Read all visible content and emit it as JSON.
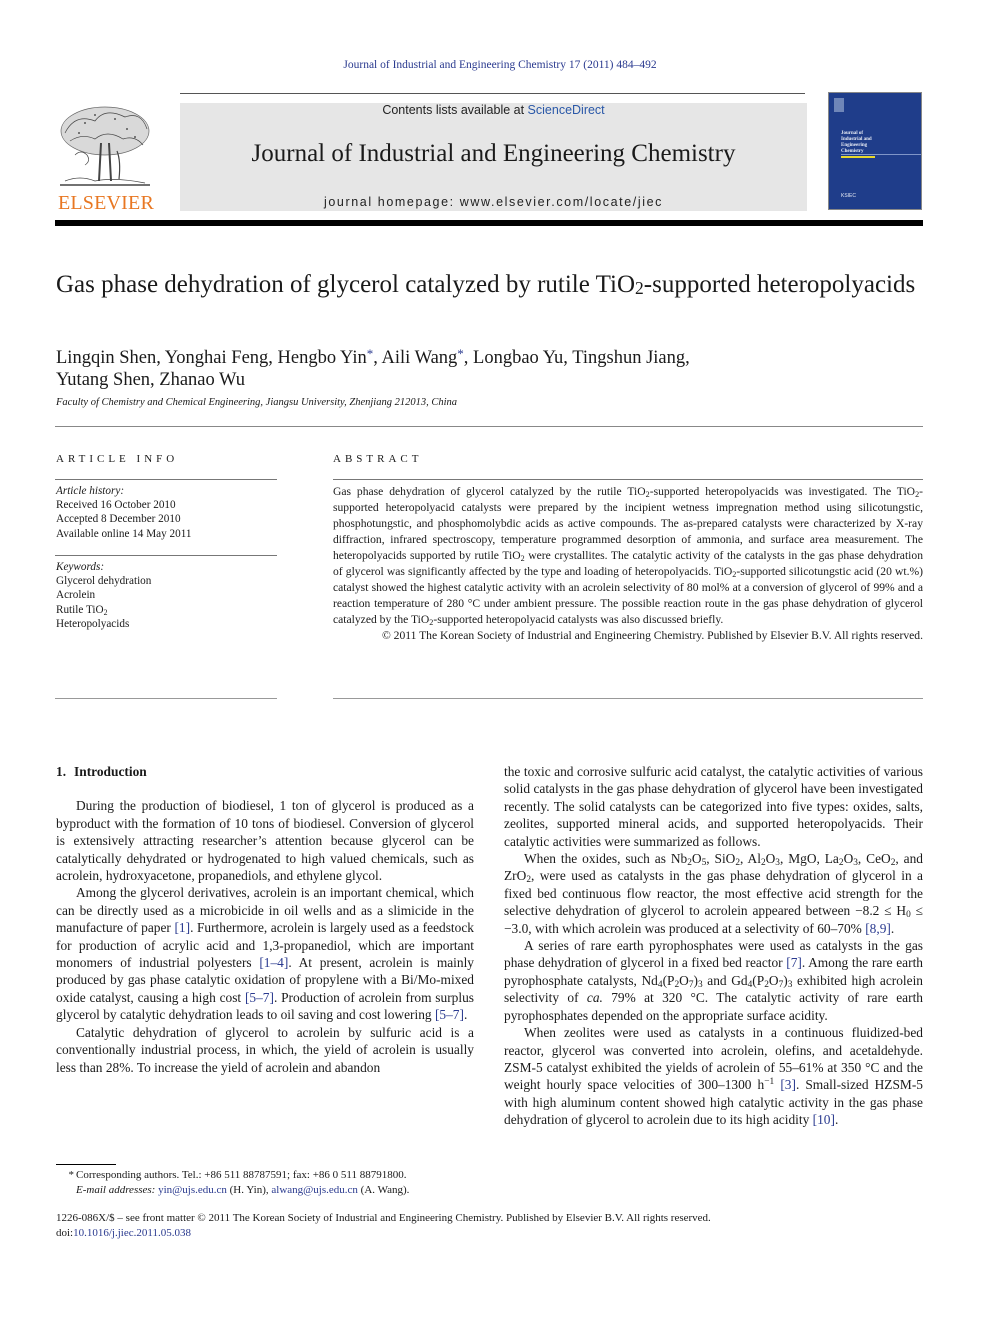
{
  "header": {
    "journal_reference": "Journal of Industrial and Engineering Chemistry 17 (2011) 484–492",
    "contents_prefix": "Contents lists available at ",
    "contents_link": "ScienceDirect",
    "journal_title": "Journal of Industrial and Engineering Chemistry",
    "homepage": "journal homepage: www.elsevier.com/locate/jiec",
    "publisher_logo_text": "ELSEVIER",
    "cover": {
      "title_lines": [
        "Journal of",
        "Industrial and",
        "Engineering",
        "Chemistry"
      ],
      "society": "The Korean Society of Industrial and Engineering Chemistry",
      "color": "#1f3d8a"
    }
  },
  "article": {
    "title_part1": "Gas phase dehydration of glycerol catalyzed by rutile TiO",
    "title_sub": "2",
    "title_part2": "-supported heteropolyacids",
    "authors": [
      {
        "name": "Lingqin Shen",
        "corresponding": false
      },
      {
        "name": "Yonghai Feng",
        "corresponding": false
      },
      {
        "name": "Hengbo Yin",
        "corresponding": true
      },
      {
        "name": "Aili Wang",
        "corresponding": true
      },
      {
        "name": "Longbao Yu",
        "corresponding": false
      },
      {
        "name": "Tingshun Jiang",
        "corresponding": false
      },
      {
        "name": "Yutang Shen",
        "corresponding": false
      },
      {
        "name": "Zhanao Wu",
        "corresponding": false
      }
    ],
    "corresponding_mark": "*",
    "affiliation": "Faculty of Chemistry and Chemical Engineering, Jiangsu University, Zhenjiang 212013, China"
  },
  "article_info": {
    "heading": "ARTICLE INFO",
    "history_label": "Article history:",
    "history": [
      "Received 16 October 2010",
      "Accepted 8 December 2010",
      "Available online 14 May 2011"
    ],
    "keywords_label": "Keywords:",
    "keywords": [
      "Glycerol dehydration",
      "Acrolein",
      "Rutile TiO",
      "Heteropolyacids"
    ],
    "keyword_sub": "2"
  },
  "abstract": {
    "heading": "ABSTRACT",
    "s1a": "Gas phase dehydration of glycerol catalyzed by the rutile TiO",
    "s1b": "-supported heteropolyacids was investigated. The TiO",
    "s1c": "-supported heteropolyacid catalysts were prepared by the incipient wetness impregnation method using silicotungstic, phosphotungstic, and phosphomolybdic acids as active compounds. The as-prepared catalysts were characterized by X-ray diffraction, infrared spectroscopy, temperature programmed desorption of ammonia, and surface area measurement. The heteropolyacids supported by rutile TiO",
    "s1d": " were crystallites. The catalytic activity of the catalysts in the gas phase dehydration of glycerol was significantly affected by the type and loading of heteropolyacids. TiO",
    "s1e": "-supported silicotungstic acid (20 wt.%) catalyst showed the highest catalytic activity with an acrolein selectivity of 80 mol% at a conversion of glycerol of 99% and a reaction temperature of 280 °C under ambient pressure. The possible reaction route in the gas phase dehydration of glycerol catalyzed by the TiO",
    "s1f": "-supported heteropolyacid catalysts was also discussed briefly.",
    "sub": "2",
    "copyright": "© 2011 The Korean Society of Industrial and Engineering Chemistry. Published by Elsevier B.V. All rights reserved."
  },
  "body": {
    "section_number": "1.",
    "section_title": "Introduction",
    "p1": "During the production of biodiesel, 1 ton of glycerol is produced as a byproduct with the formation of 10 tons of biodiesel. Conversion of glycerol is extensively attracting researcher’s attention because glycerol can be catalytically dehydrated or hydrogenated to high valued chemicals, such as acrolein, hydroxyacetone, propanediols, and ethylene glycol.",
    "p2a": "Among the glycerol derivatives, acrolein is an important chemical, which can be directly used as a microbicide in oil wells and as a slimicide in the manufacture of paper ",
    "p2_ref1": "[1]",
    "p2b": ". Furthermore, acrolein is largely used as a feedstock for production of acrylic acid and 1,3-propanediol, which are important monomers of industrial polyesters ",
    "p2_ref2": "[1–4]",
    "p2c": ". At present, acrolein is mainly produced by gas phase catalytic oxidation of propylene with a Bi/Mo-mixed oxide catalyst, causing a high cost ",
    "p2_ref3": "[5–7]",
    "p2d": ". Production of acrolein from surplus glycerol by catalytic dehydration leads to oil saving and cost lowering ",
    "p2_ref4": "[5–7]",
    "p2e": ".",
    "p3": "Catalytic dehydration of glycerol to acrolein by sulfuric acid is a conventionally industrial process, in which, the yield of acrolein is usually less than 28%. To increase the yield of acrolein and abandon",
    "p3_cont": "the toxic and corrosive sulfuric acid catalyst, the catalytic activities of various solid catalysts in the gas phase dehydration of glycerol have been investigated recently. The solid catalysts can be categorized into five types: oxides, salts, zeolites, supported mineral acids, and supported heteropolyacids. Their catalytic activities were summarized as follows.",
    "p4": {
      "a": "When the oxides, such as Nb",
      "b": "O",
      "c": ", SiO",
      "d": ", Al",
      "e": "O",
      "f": ", MgO, La",
      "g": "O",
      "h": ", CeO",
      "i": ", and ZrO",
      "j": ", were used as catalysts in the gas phase dehydration of glycerol in a fixed bed continuous flow reactor, the most effective acid strength for the selective dehydration of glycerol to acrolein appeared between −8.2 ≤ H",
      "k": " ≤ −3.0, with which acrolein was produced at a selectivity of 60–70% ",
      "ref": "[8,9]",
      "end": "."
    },
    "p5": {
      "a": "A series of rare earth pyrophosphates were used as catalysts in the gas phase dehydration of glycerol in a fixed bed reactor ",
      "ref1": "[7]",
      "b": ". Among the rare earth pyrophosphate catalysts, Nd",
      "c": "(P",
      "d": "O",
      "e": ")",
      "f": " and Gd",
      "g": "(P",
      "h": "O",
      "i": ")",
      "j": " exhibited high acrolein selectivity of ",
      "ca": "ca.",
      "k": " 79% at 320 °C. The catalytic activity of rare earth pyrophosphates depended on the appropriate surface acidity."
    },
    "p6": {
      "a": "When zeolites were used as catalysts in a continuous fluidized-bed reactor, glycerol was converted into acrolein, olefins, and acetaldehyde. ZSM-5 catalyst exhibited the yields of acrolein of 55–61% at 350 °C and the weight hourly space velocities of 300–1300 h",
      "sup": "−1",
      "ref1": "[3]",
      "b": ". Small-sized HZSM-5 with high aluminum content showed high catalytic activity in the gas phase dehydration of glycerol to acrolein due to its high acidity ",
      "ref2": "[10]",
      "c": "."
    },
    "subs": {
      "two": "2",
      "three": "3",
      "four": "4",
      "five": "5",
      "seven": "7",
      "zero": "0"
    }
  },
  "footnote": {
    "mark": "*",
    "corresponding": "Corresponding authors. Tel.: +86 511 88787591; fax: +86 0 511 88791800.",
    "email_label": "E-mail addresses:",
    "email1": "yin@ujs.edu.cn",
    "email1_owner": " (H. Yin), ",
    "email2": "alwang@ujs.edu.cn",
    "email2_owner": " (A. Wang)."
  },
  "bottom": {
    "front_matter": "1226-086X/$ – see front matter © 2011 The Korean Society of Industrial and Engineering Chemistry. Published by Elsevier B.V. All rights reserved.",
    "doi_prefix": "doi:",
    "doi": "10.1016/j.jiec.2011.05.038"
  },
  "colors": {
    "link": "#2a3a8f",
    "elsevier_orange": "#e87722",
    "banner_bg": "#e6e6e6"
  }
}
